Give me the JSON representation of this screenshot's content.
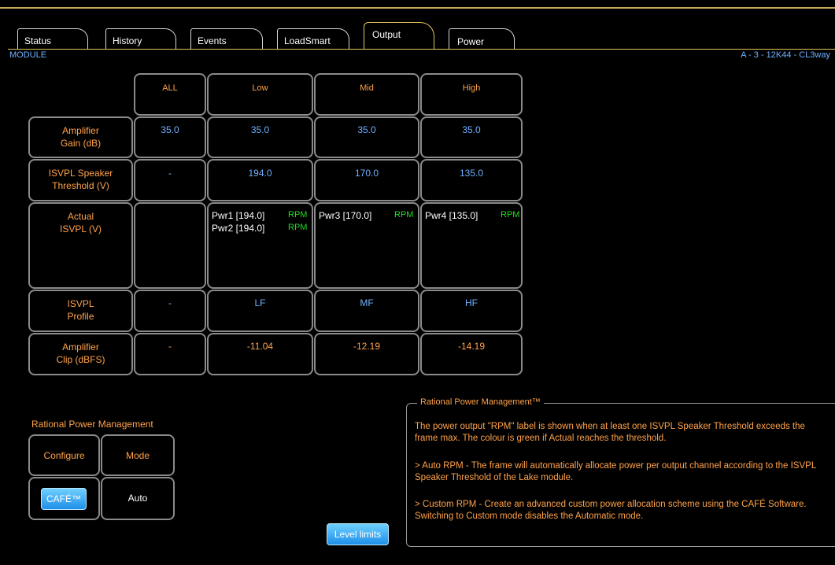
{
  "tabs": [
    {
      "label": "Status"
    },
    {
      "label": "History"
    },
    {
      "label": "Events"
    },
    {
      "label": "LoadSmart"
    },
    {
      "label": "Output"
    },
    {
      "label": "Power"
    }
  ],
  "module": {
    "label": "MODULE",
    "id": "A - 3 - 12K44 - CL3way"
  },
  "grid": {
    "columns": [
      "ALL",
      "Low",
      "Mid",
      "High"
    ],
    "rows": [
      {
        "label": "Amplifier\nGain (dB)",
        "values": [
          "35.0",
          "35.0",
          "35.0",
          "35.0"
        ]
      },
      {
        "label": "ISVPL Speaker\nThreshold (V)",
        "values": [
          "-",
          "194.0",
          "170.0",
          "135.0"
        ]
      },
      {
        "label": "Actual\nISVPL (V)"
      },
      {
        "label": "ISVPL\nProfile",
        "values": [
          "-",
          "LF",
          "MF",
          "HF"
        ]
      },
      {
        "label": "Amplifier\nClip (dBFS)",
        "values": [
          "-",
          "-11.04",
          "-12.19",
          "-14.19"
        ]
      }
    ],
    "actual": {
      "low": [
        {
          "text": "Pwr1 [194.0]",
          "badge": "RPM"
        },
        {
          "text": "Pwr2 [194.0]",
          "badge": "RPM"
        }
      ],
      "mid": [
        {
          "text": "Pwr3 [170.0]",
          "badge": "RPM"
        }
      ],
      "high": [
        {
          "text": "Pwr4 [135.0]",
          "badge": "RPM"
        }
      ]
    }
  },
  "rpm_panel": {
    "title": "Rational Power Management",
    "configure_label": "Configure",
    "mode_label": "Mode",
    "cafe_button": "CAFÉ™",
    "mode_value": "Auto"
  },
  "level_limits_button": "Level limits",
  "info": {
    "title": "Rational Power Management™",
    "p1": "The power output \"RPM\" label is shown when at least one ISVPL Speaker Threshold exceeds the frame max. The colour is green if Actual reaches the threshold.",
    "p2": "> Auto RPM - The frame will automatically allocate power per output channel according to the ISVPL Speaker Threshold of the Lake module.",
    "p3": "> Custom RPM - Create an advanced custom power allocation scheme using the CAFÉ Software. Switching to Custom mode disables the Automatic mode."
  },
  "colors": {
    "orange": "#ffa24a",
    "blue": "#6fb0ff",
    "green": "#22dd22",
    "gold": "#e6c85c"
  }
}
